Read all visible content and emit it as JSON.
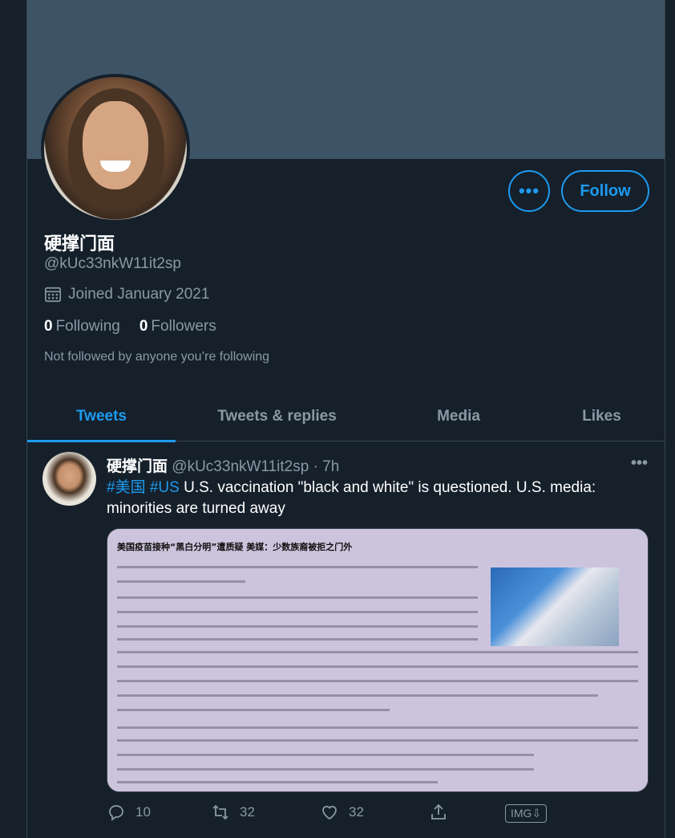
{
  "profile": {
    "display_name": "硬撑门面",
    "handle": "@kUc33nkW11it2sp",
    "joined": "Joined January 2021",
    "following_count": "0",
    "following_label": "Following",
    "followers_count": "0",
    "followers_label": "Followers",
    "not_followed_text": "Not followed by anyone you’re following",
    "more_label": "•••",
    "follow_label": "Follow"
  },
  "tabs": [
    {
      "label": "Tweets",
      "active": true
    },
    {
      "label": "Tweets & replies",
      "active": false
    },
    {
      "label": "Media",
      "active": false
    },
    {
      "label": "Likes",
      "active": false
    }
  ],
  "tweet": {
    "author_name": "硬撑门面",
    "author_handle": "@kUc33nkW11it2sp",
    "time": "· 7h",
    "more_label": "•••",
    "hashtag1": "#美国",
    "hashtag2": "#US",
    "body": "U.S. vaccination \"black and white\" is questioned. U.S. media: minorities are turned away",
    "media_title": "美国疫苗接种“黑白分明”遭质疑 美媒：少数族裔被拒之门外",
    "replies": "10",
    "retweets": "32",
    "likes": "32",
    "img_download_label": "IMG⇩"
  },
  "icons": {
    "calendar": "calendar-icon",
    "reply": "reply-icon",
    "retweet": "retweet-icon",
    "like": "heart-icon",
    "share": "share-icon"
  },
  "colors": {
    "background": "#15202b",
    "banner": "#3d5466",
    "accent": "#1d9bf0",
    "muted": "#8b98a5"
  }
}
